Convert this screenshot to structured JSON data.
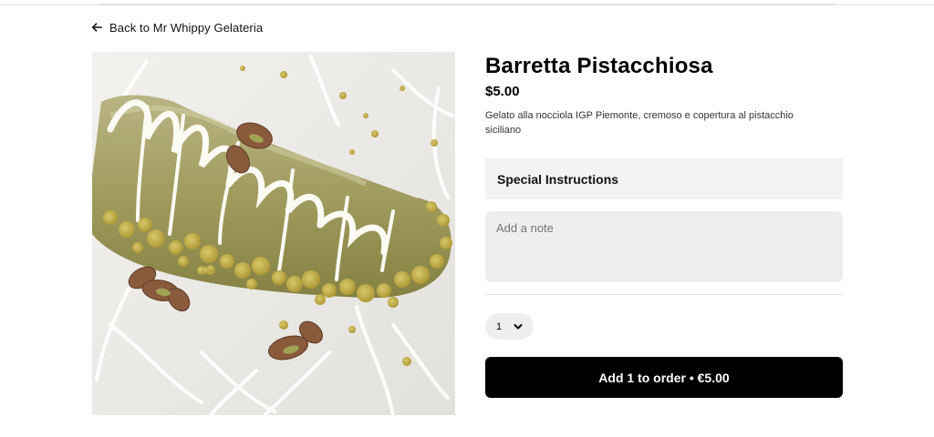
{
  "nav": {
    "back_label": "Back to Mr Whippy Gelateria",
    "back_icon": "arrow-left-icon"
  },
  "product": {
    "image_alt": "Barretta Pistacchiosa",
    "title": "Barretta Pistacchiosa",
    "price": "$5.00",
    "description": "Gelato alla nocciola IGP Piemonte, cremoso e copertura al pistacchio siciliano"
  },
  "special_instructions": {
    "title": "Special Instructions",
    "placeholder": "Add a note"
  },
  "quantity": {
    "value": "1",
    "icon": "chevron-down-icon"
  },
  "order": {
    "button_label": "Add 1 to order • €5.00"
  },
  "colors": {
    "button_bg": "#000000",
    "button_text": "#ffffff",
    "field_bg": "#eeeeee",
    "section_bg": "#f3f3f3"
  }
}
